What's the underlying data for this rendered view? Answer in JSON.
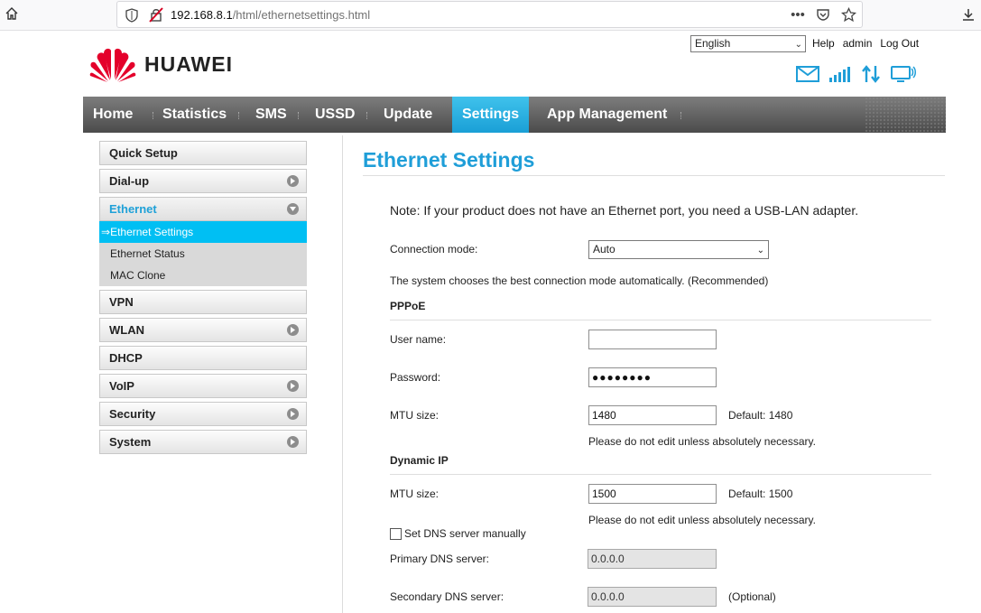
{
  "browser": {
    "url_host": "192.168.8.1",
    "url_path": "/html/ethernetsettings.html"
  },
  "header": {
    "brand": "HUAWEI",
    "language": "English",
    "links": [
      "Help",
      "admin",
      "Log Out"
    ]
  },
  "nav": {
    "items": [
      "Home",
      "Statistics",
      "SMS",
      "USSD",
      "Update",
      "Settings",
      "App Management"
    ],
    "active": "Settings"
  },
  "sidebar": {
    "items": [
      {
        "label": "Quick Setup",
        "arrow": false
      },
      {
        "label": "Dial-up",
        "arrow": true
      },
      {
        "label": "Ethernet",
        "arrow": true,
        "expanded": true
      },
      {
        "label": "VPN",
        "arrow": false
      },
      {
        "label": "WLAN",
        "arrow": true
      },
      {
        "label": "DHCP",
        "arrow": false
      },
      {
        "label": "VoIP",
        "arrow": true
      },
      {
        "label": "Security",
        "arrow": true
      },
      {
        "label": "System",
        "arrow": true
      }
    ],
    "sub_items": [
      "Ethernet Settings",
      "Ethernet Status",
      "MAC Clone"
    ],
    "active_sub_prefix": "⇒"
  },
  "main": {
    "title": "Ethernet Settings",
    "note": "Note: If your product does not have an Ethernet port, you need a USB-LAN adapter.",
    "connection_mode_label": "Connection mode:",
    "connection_mode_value": "Auto",
    "auto_hint": "The system chooses the best connection mode automatically. (Recommended)",
    "pppoe": {
      "heading": "PPPoE",
      "username_label": "User name:",
      "username_value": "",
      "password_label": "Password:",
      "password_value": "●●●●●●●●",
      "mtu_label": "MTU size:",
      "mtu_value": "1480",
      "mtu_default": "Default: 1480",
      "mtu_hint": "Please do not edit unless absolutely necessary."
    },
    "dynamic_ip": {
      "heading": "Dynamic IP",
      "mtu_label": "MTU size:",
      "mtu_value": "1500",
      "mtu_default": "Default: 1500",
      "mtu_hint": "Please do not edit unless absolutely necessary.",
      "dns_manual_label": "Set DNS server manually",
      "primary_dns_label": "Primary DNS server:",
      "primary_dns_value": "0.0.0.0",
      "secondary_dns_label": "Secondary DNS server:",
      "secondary_dns_value": "0.0.0.0",
      "optional": "(Optional)"
    }
  },
  "colors": {
    "accent": "#1f9ed8",
    "nav_active": "#2fb3e6",
    "sub_active": "#00bff3",
    "brand_red": "#e4002b"
  }
}
